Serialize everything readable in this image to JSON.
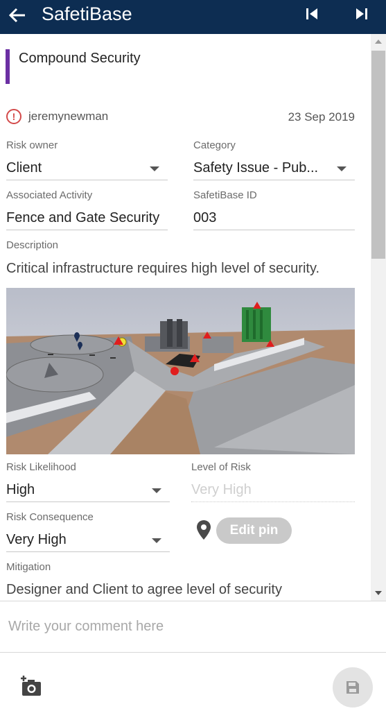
{
  "app": {
    "title": "SafetiBase"
  },
  "risk": {
    "title": "Compound Security",
    "author": "jeremynewman",
    "date": "23 Sep 2019",
    "accent_color": "#6b2fa3"
  },
  "fields": {
    "risk_owner": {
      "label": "Risk owner",
      "value": "Client"
    },
    "category": {
      "label": "Category",
      "value": "Safety Issue - Pub..."
    },
    "associated_activity": {
      "label": "Associated Activity",
      "value": "Fence and Gate Security"
    },
    "safetibase_id": {
      "label": "SafetiBase ID",
      "value": "003"
    },
    "description": {
      "label": "Description",
      "value": "Critical infrastructure requires high level of security."
    },
    "risk_likelihood": {
      "label": "Risk Likelihood",
      "value": "High"
    },
    "level_of_risk": {
      "label": "Level of Risk",
      "value": "Very High"
    },
    "risk_consequence": {
      "label": "Risk Consequence",
      "value": "Very High"
    },
    "mitigation": {
      "label": "Mitigation",
      "value": "Designer and Client to agree level of security"
    }
  },
  "edit_pin": {
    "label": "Edit pin"
  },
  "comment": {
    "placeholder": "Write your comment here"
  },
  "icons": {
    "back": "arrow-left-icon",
    "first": "skip-first-icon",
    "last": "skip-last-icon",
    "warning": "alert-circle-icon",
    "pin": "map-pin-icon",
    "camera": "add-photo-icon",
    "save": "floppy-disk-icon"
  },
  "colors": {
    "app_bar": "#0d2d52",
    "warning": "#d34a4a"
  }
}
